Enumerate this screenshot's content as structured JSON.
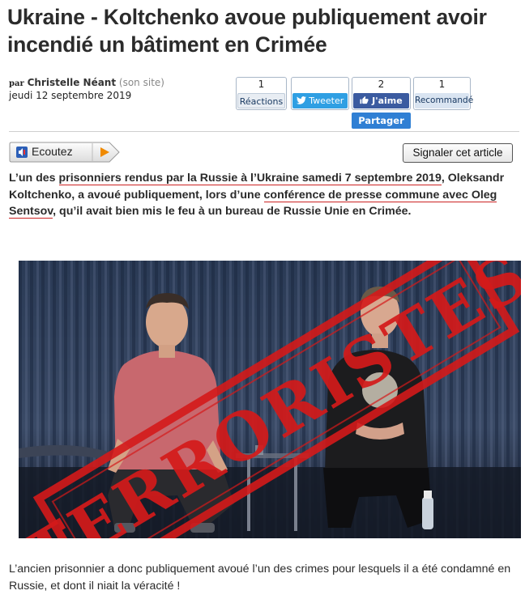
{
  "article": {
    "title": "Ukraine - Koltchenko avoue publiquement avoir incendié un bâtiment en Crimée",
    "byline": {
      "prefix": "par",
      "author": "Christelle Néant",
      "site_link": "(son site)",
      "date": "jeudi 12 septembre 2019"
    },
    "lead": {
      "t1": "L’un des ",
      "l1": "prisonniers rendus par la Russie à l’Ukraine samedi 7 septembre 2019",
      "t2": ", Oleksandr Koltchenko, a avoué publiquement, lors d’une ",
      "l2": "conférence de presse commune avec Oleg Sentsov",
      "t3": ", qu’il avait bien mis le feu à un bureau de Russie Unie en Crimée."
    },
    "image": {
      "stamp_text": "TERRORISTES"
    },
    "caption": "L’ancien prisonnier a donc publiquement avoué l’un des crimes pour lesquels il a été condamné en Russie, et dont il niait la véracité !"
  },
  "social": {
    "reactions": {
      "count": "1",
      "label": "Réactions"
    },
    "tweet": {
      "count": "",
      "label": "Tweeter"
    },
    "facebook": {
      "count": "2",
      "label": "J'aime"
    },
    "recommend": {
      "count": "1",
      "label": "Recommandé"
    },
    "share_label": "Partager"
  },
  "toolbar": {
    "listen_label": "Ecoutez",
    "report_label": "Signaler cet article"
  },
  "icons": {
    "speaker": "speaker-icon",
    "play": "play-icon",
    "twitter": "twitter-bird-icon",
    "like": "thumbs-up-icon"
  },
  "colors": {
    "stamp_red": "#d41a1a",
    "link_underline": "#cc2222",
    "twitter_blue": "#2f9fe3",
    "facebook_blue": "#3b5ba0",
    "share_blue": "#2f7fd4",
    "play_orange": "#f08a00"
  }
}
